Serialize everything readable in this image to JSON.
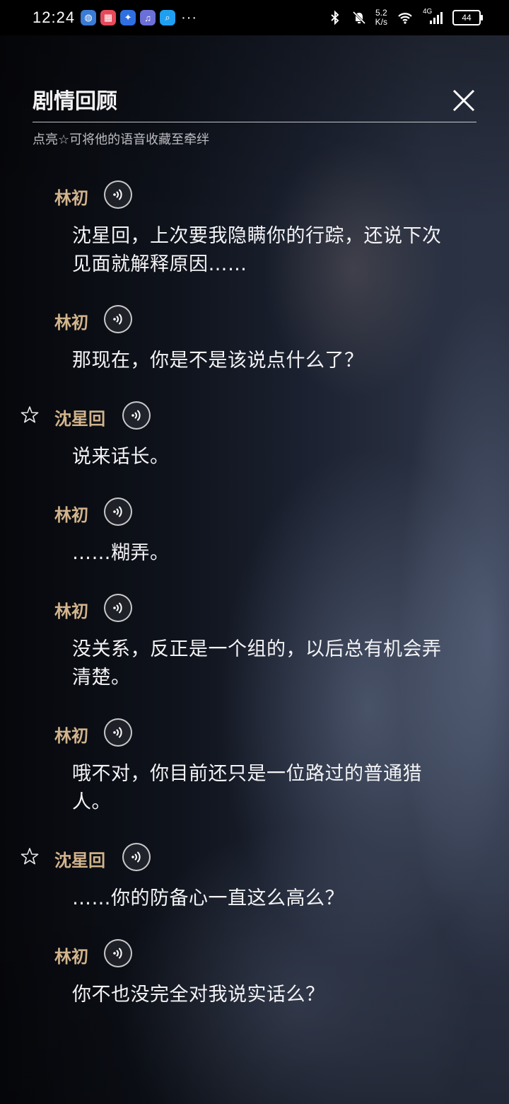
{
  "status_bar": {
    "time": "12:24",
    "more": "···",
    "net_speed_value": "5.2",
    "net_speed_unit": "K/s",
    "network": "4G",
    "battery": "44"
  },
  "panel": {
    "title": "剧情回顾",
    "hint": "点亮☆可将他的语音收藏至牵绊"
  },
  "dialogue": [
    {
      "speaker": "林初",
      "favoritable": false,
      "text": "沈星回，上次要我隐瞒你的行踪，还说下次见面就解释原因……"
    },
    {
      "speaker": "林初",
      "favoritable": false,
      "text": "那现在，你是不是该说点什么了？"
    },
    {
      "speaker": "沈星回",
      "favoritable": true,
      "text": "说来话长。"
    },
    {
      "speaker": "林初",
      "favoritable": false,
      "text": "……糊弄。"
    },
    {
      "speaker": "林初",
      "favoritable": false,
      "text": "没关系，反正是一个组的，以后总有机会弄清楚。"
    },
    {
      "speaker": "林初",
      "favoritable": false,
      "text": "哦不对，你目前还只是一位路过的普通猎人。"
    },
    {
      "speaker": "沈星回",
      "favoritable": true,
      "text": "……你的防备心一直这么高么？"
    },
    {
      "speaker": "林初",
      "favoritable": false,
      "text": "你不也没完全对我说实话么？"
    },
    {
      "speaker": "林初",
      "favoritable": false,
      "text": ""
    }
  ],
  "colors": {
    "speaker": "#d2b48c",
    "text": "#f4f4f6",
    "background": "#0e1118"
  },
  "icons": {
    "close": "close-icon",
    "voice": "voice-play-icon",
    "favorite": "star-outline-icon"
  }
}
